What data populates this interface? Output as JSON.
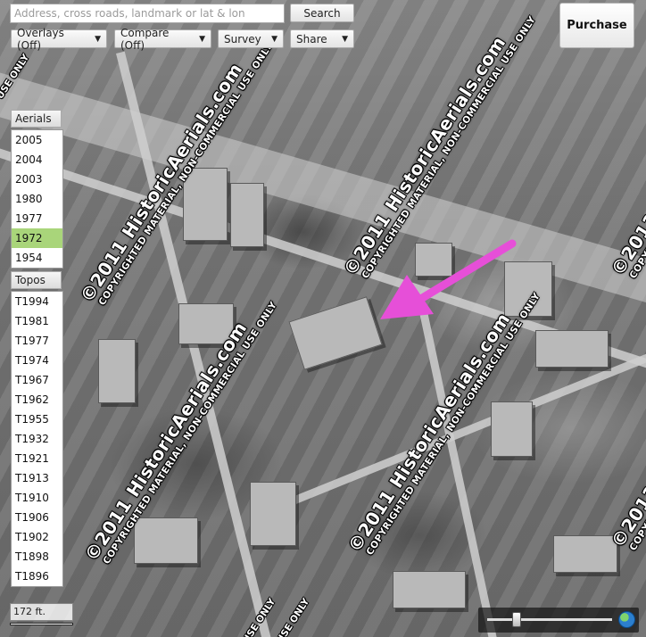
{
  "search": {
    "placeholder": "Address, cross roads, landmark or lat & lon",
    "button_label": "Search"
  },
  "toolbar": {
    "overlays_label": "Overlays (Off)",
    "compare_label": "Compare (Off)",
    "survey_label": "Survey",
    "share_label": "Share"
  },
  "purchase_label": "Purchase",
  "aerials": {
    "header": "Aerials",
    "years": [
      "2005",
      "2004",
      "2003",
      "1980",
      "1977",
      "1972",
      "1954"
    ],
    "selected": "1972"
  },
  "topos": {
    "header": "Topos",
    "years": [
      "T1994",
      "T1981",
      "T1977",
      "T1974",
      "T1967",
      "T1962",
      "T1955",
      "T1932",
      "T1921",
      "T1913",
      "T1910",
      "T1906",
      "T1902",
      "T1898",
      "T1896"
    ]
  },
  "scale_label": "172 ft.",
  "watermark": {
    "main": "©2011 HistoricAerials.com",
    "sub": "COPYRIGHTED MATERIAL, NON-COMMERCIAL USE ONLY",
    "edge": "USE ONLY"
  },
  "zoom": {
    "level": 0.2
  },
  "colors": {
    "selected_year": "#a9d57a",
    "arrow": "#e64fd8"
  }
}
